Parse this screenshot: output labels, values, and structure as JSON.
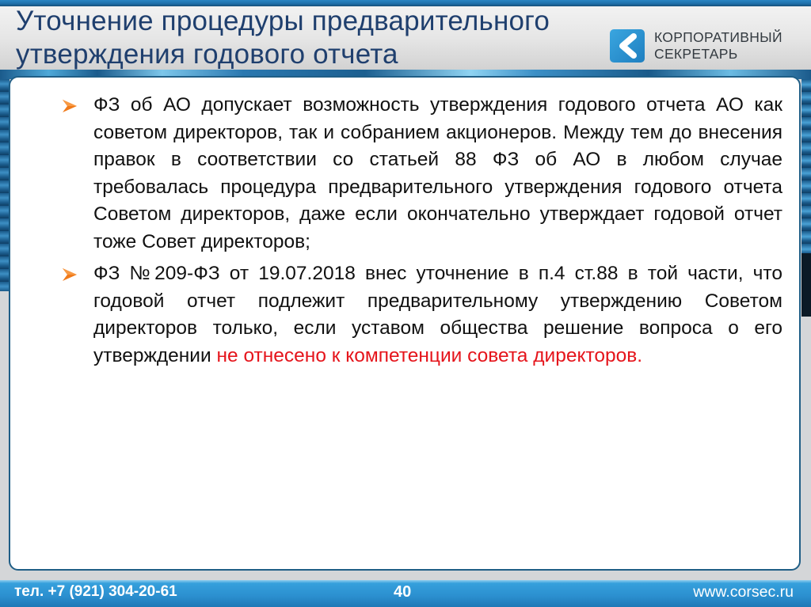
{
  "header": {
    "title_line1": "Уточнение процедуры предварительного",
    "title_line2": "утверждения годового отчета",
    "logo": {
      "icon": "corsec-logo-icon",
      "line1": "КОРПОРАТИВНЫЙ",
      "line2": "СЕКРЕТАРЬ"
    }
  },
  "content": {
    "bullet_icon": "orange-arrow-bullet-icon",
    "bullets": [
      {
        "text": "ФЗ об АО допускает возможность утверждения годового отчета АО как советом директоров, так и собранием акционеров. Между тем до внесения правок в соответствии со статьей 88 ФЗ об АО в любом случае требовалась процедура предварительного утверждения годового отчета Советом директоров, даже если окончательно утверждает годовой отчет тоже Совет директоров;"
      },
      {
        "text": "ФЗ №209-ФЗ от 19.07.2018 внес уточнение в п.4 ст.88  в той части, что годовой отчет подлежит предварительному утверждению Советом директоров только, если уставом общества решение вопроса о его утверждении ",
        "highlight": "не отнесено к компетенции совета директоров."
      }
    ]
  },
  "footer": {
    "phone": "тел. +7 (921) 304-20-61",
    "page_number": "40",
    "website": "www.corsec.ru"
  },
  "colors": {
    "title": "#1f3f6e",
    "bullet_arrow": "#f07a1a",
    "highlight": "#e5141b",
    "footer_bg": "#2b8fcf",
    "logo_mark": "#2a90d0"
  }
}
